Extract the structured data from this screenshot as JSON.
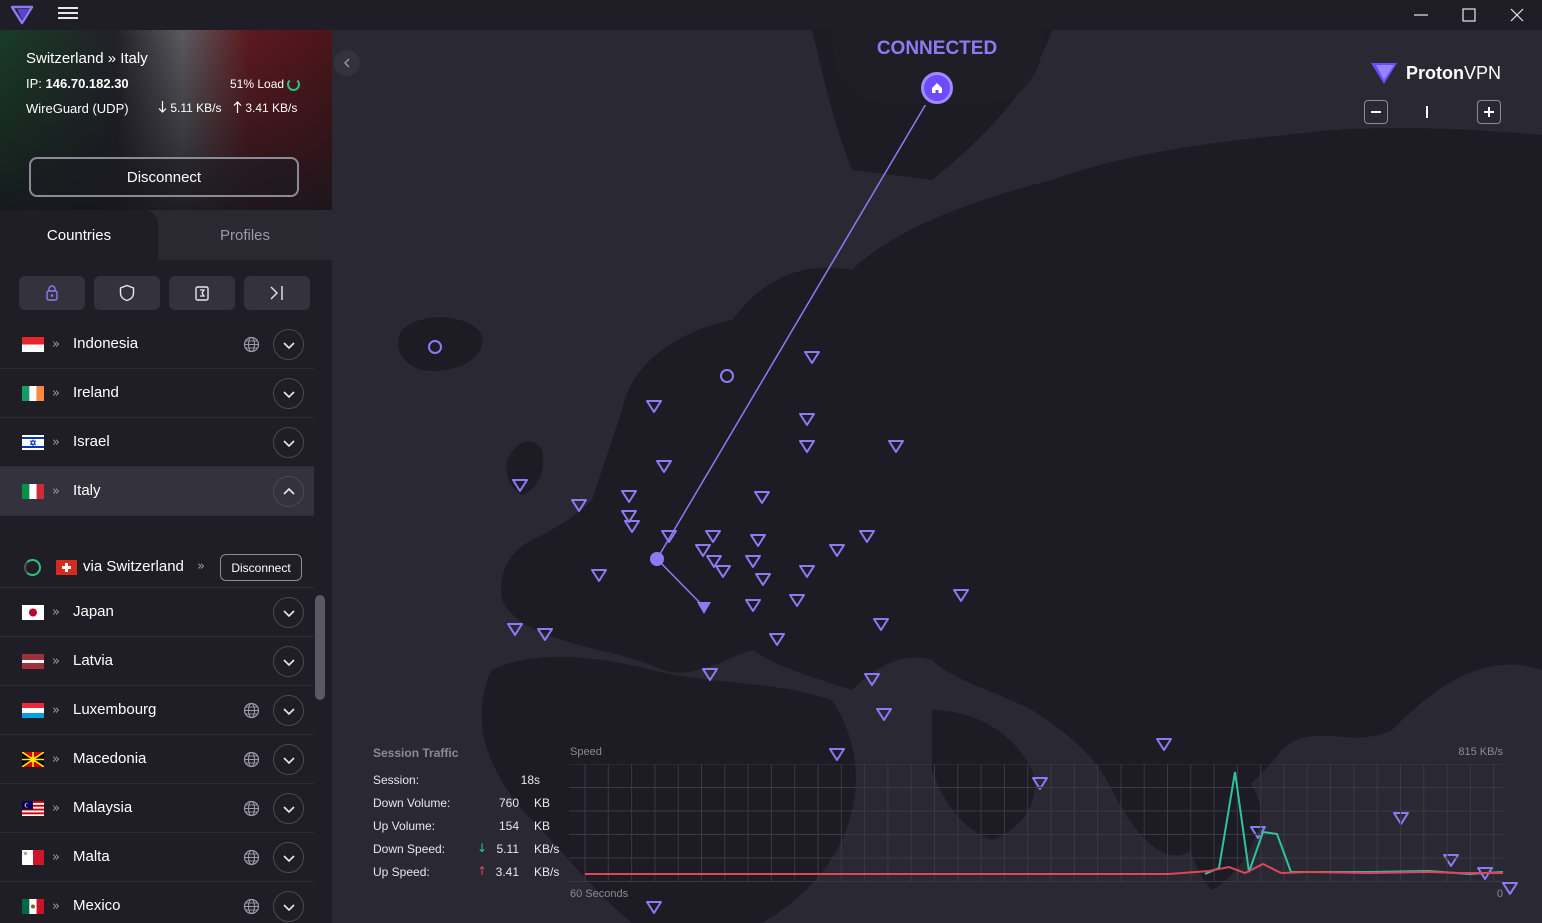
{
  "titlebar": {
    "icons": [
      "proton-logo-icon",
      "hamburger-menu-icon",
      "minimize-icon",
      "maximize-icon",
      "close-icon"
    ]
  },
  "connection": {
    "route": "Switzerland » Italy",
    "ip_label": "IP:",
    "ip": "146.70.182.30",
    "load": "51% Load",
    "protocol": "WireGuard (UDP)",
    "down_speed": "5.11 KB/s",
    "up_speed": "3.41 KB/s",
    "disconnect_label": "Disconnect"
  },
  "tabs": {
    "countries": "Countries",
    "profiles": "Profiles"
  },
  "filters": [
    "secure-core-icon",
    "shield-icon",
    "p2p-icon",
    "tor-icon"
  ],
  "countries": [
    {
      "name": "Indonesia",
      "globe": true,
      "expanded": false
    },
    {
      "name": "Ireland",
      "globe": false,
      "expanded": false
    },
    {
      "name": "Israel",
      "globe": false,
      "expanded": false
    },
    {
      "name": "Italy",
      "globe": false,
      "expanded": true
    },
    {
      "name": "Japan",
      "globe": false,
      "expanded": false
    },
    {
      "name": "Latvia",
      "globe": false,
      "expanded": false
    },
    {
      "name": "Luxembourg",
      "globe": true,
      "expanded": false
    },
    {
      "name": "Macedonia",
      "globe": true,
      "expanded": false
    },
    {
      "name": "Malaysia",
      "globe": true,
      "expanded": false
    },
    {
      "name": "Malta",
      "globe": true,
      "expanded": false
    },
    {
      "name": "Mexico",
      "globe": true,
      "expanded": false
    }
  ],
  "subrow": {
    "label": "via Switzerland",
    "disconnect_label": "Disconnect"
  },
  "map": {
    "status": "CONNECTED",
    "brand_name": "Proton",
    "brand_suffix": "VPN",
    "accent": "#6d4aff",
    "accent_light": "#8b7cf6"
  },
  "traffic": {
    "title": "Session Traffic",
    "session_label": "Session:",
    "session_value": "18s",
    "down_volume_label": "Down Volume:",
    "down_volume_value": "760",
    "down_volume_unit": "KB",
    "up_volume_label": "Up Volume:",
    "up_volume_value": "154",
    "up_volume_unit": "KB",
    "down_speed_label": "Down Speed:",
    "down_speed_value": "5.11",
    "down_speed_unit": "KB/s",
    "up_speed_label": "Up Speed:",
    "up_speed_value": "3.41",
    "up_speed_unit": "KB/s",
    "speed_title": "Speed",
    "speed_max": "815 KB/s",
    "axis_start": "60 Seconds",
    "axis_end": "0",
    "down_color": "#2ec2a0",
    "up_color": "#e0455a"
  }
}
